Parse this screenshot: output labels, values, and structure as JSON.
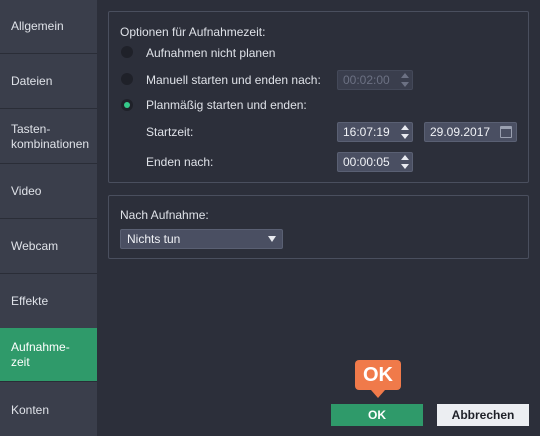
{
  "sidebar": {
    "items": [
      {
        "label": "Allgemein",
        "active": false
      },
      {
        "label": "Dateien",
        "active": false
      },
      {
        "label": "Tasten-\nkombinationen",
        "active": false
      },
      {
        "label": "Video",
        "active": false
      },
      {
        "label": "Webcam",
        "active": false
      },
      {
        "label": "Effekte",
        "active": false
      },
      {
        "label": "Aufnahme-\nzeit",
        "active": true
      },
      {
        "label": "Konten",
        "active": false
      }
    ]
  },
  "recording_time": {
    "title": "Optionen für Aufnahmezeit:",
    "options": [
      {
        "label": "Aufnahmen nicht planen",
        "checked": false
      },
      {
        "label": "Manuell starten und enden nach:",
        "checked": false,
        "value": "00:02:00",
        "disabled": true
      },
      {
        "label": "Planmäßig starten und enden:",
        "checked": true
      }
    ],
    "start_label": "Startzeit:",
    "start_time": "16:07:19",
    "start_date": "29.09.2017",
    "end_label": "Enden nach:",
    "end_after": "00:00:05"
  },
  "after_recording": {
    "title": "Nach Aufnahme:",
    "selected": "Nichts tun"
  },
  "buttons": {
    "ok": "OK",
    "cancel": "Abbrechen"
  },
  "callout": {
    "text": "OK",
    "color": "#f07a4a"
  },
  "colors": {
    "accent": "#2f9a6a",
    "background": "#2c2f3a",
    "sidebar": "#3a3e4b"
  }
}
